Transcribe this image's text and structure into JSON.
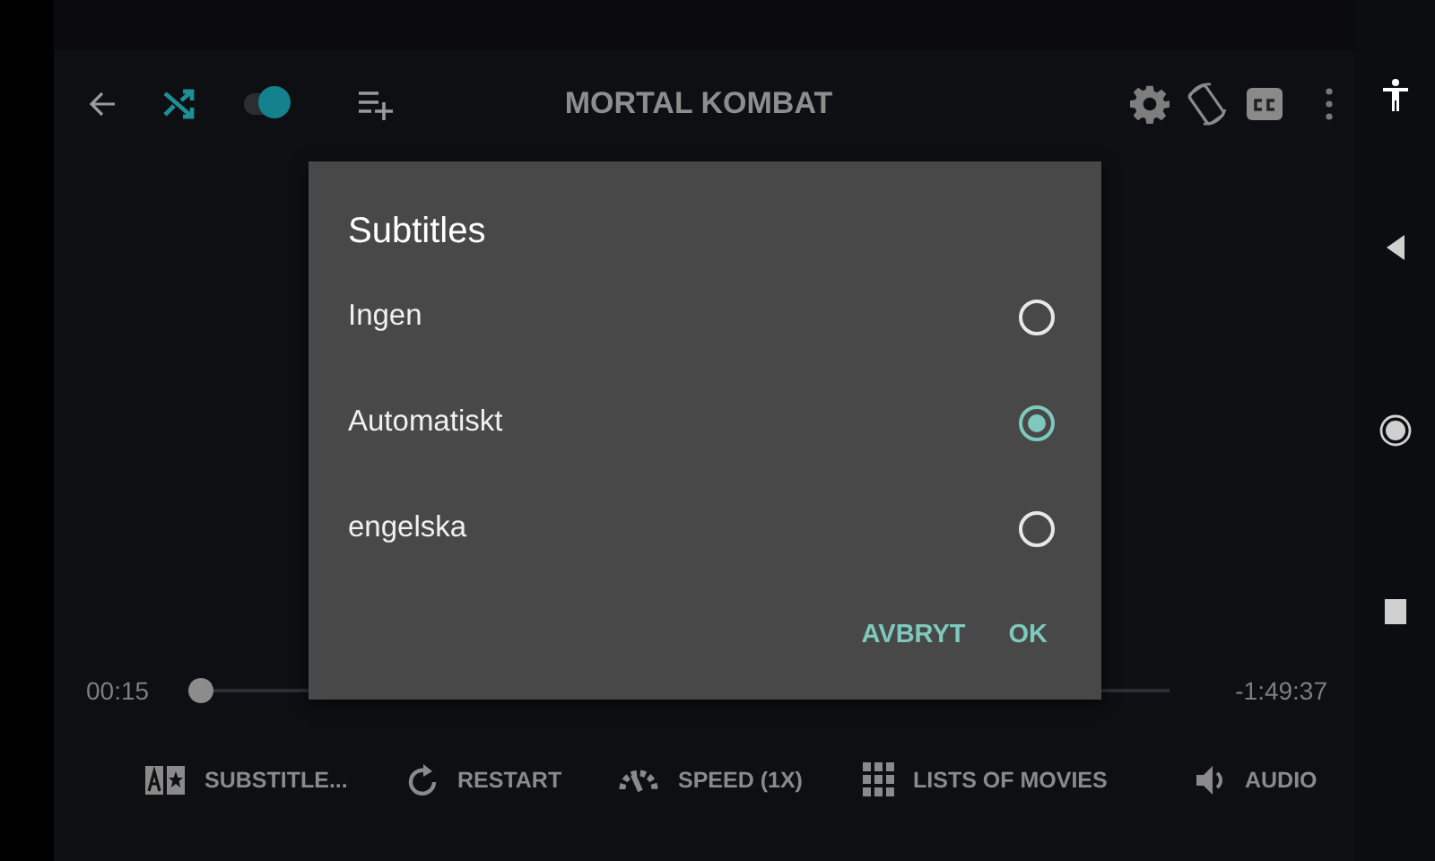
{
  "top_bar": {
    "title": "MORTAL KOMBAT",
    "toggle": {
      "on": true
    }
  },
  "dialog": {
    "title": "Subtitles",
    "options": [
      {
        "label": "Ingen",
        "selected": false
      },
      {
        "label": "Automatiskt",
        "selected": true
      },
      {
        "label": "engelska",
        "selected": false
      }
    ],
    "buttons": [
      "AVBRYT",
      "OK"
    ]
  },
  "seek_bar": {
    "elapsed": "00:15",
    "remaining": "-1:49:37",
    "level": 0
  },
  "toolbar": [
    {
      "kind": "subtitles",
      "label": "SUBSTITLE..."
    },
    {
      "kind": "restart",
      "label": "RESTART"
    },
    {
      "kind": "speed",
      "label": "SPEED (1X)"
    },
    {
      "kind": "grid",
      "label": "LISTS OF MOVIES"
    },
    {
      "kind": "audio",
      "label": "AUDIO"
    }
  ]
}
